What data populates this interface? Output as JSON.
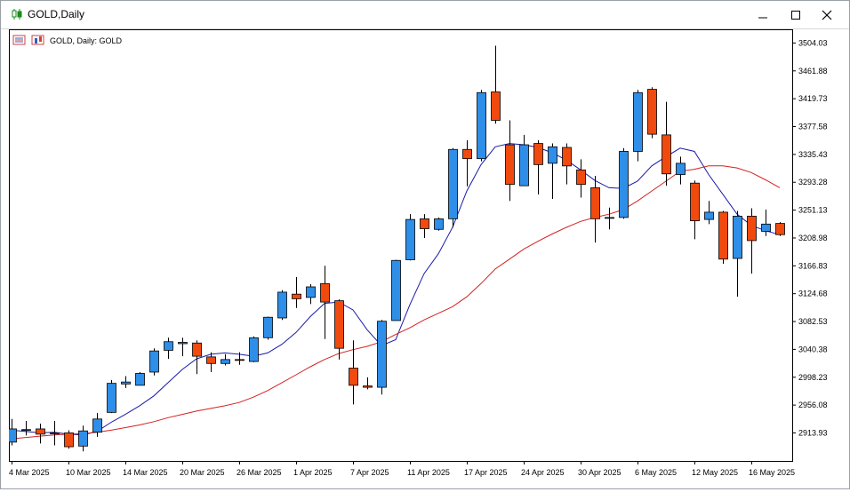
{
  "window": {
    "title": "GOLD,Daily",
    "icons": {
      "app": "candlestick-icon",
      "minimize": "minimize-icon",
      "maximize": "maximize-icon",
      "close": "close-icon"
    }
  },
  "chart_header": {
    "label": "GOLD, Daily:  GOLD",
    "icons": [
      "indicator-list-icon",
      "chart-type-icon"
    ]
  },
  "colors": {
    "bull": "#2e8ee8",
    "bear": "#f04a0f",
    "ma_fast": "#1a1aa8",
    "ma_slow": "#d42020",
    "axis": "#000000"
  },
  "chart_data": {
    "type": "candlestick",
    "symbol": "GOLD",
    "timeframe": "Daily",
    "ylim": [
      2885,
      3510
    ],
    "y_ticks": [
      "3504.03",
      "3461.88",
      "3419.73",
      "3377.58",
      "3335.43",
      "3293.28",
      "3251.13",
      "3208.98",
      "3166.83",
      "3124.68",
      "3082.53",
      "3040.38",
      "2998.23",
      "2956.08",
      "2913.93"
    ],
    "x_tick_labels": [
      {
        "index": 0,
        "label": "4 Mar 2025"
      },
      {
        "index": 4,
        "label": "10 Mar 2025"
      },
      {
        "index": 8,
        "label": "14 Mar 2025"
      },
      {
        "index": 12,
        "label": "20 Mar 2025"
      },
      {
        "index": 16,
        "label": "26 Mar 2025"
      },
      {
        "index": 20,
        "label": "1 Apr 2025"
      },
      {
        "index": 24,
        "label": "7 Apr 2025"
      },
      {
        "index": 28,
        "label": "11 Apr 2025"
      },
      {
        "index": 32,
        "label": "17 Apr 2025"
      },
      {
        "index": 36,
        "label": "24 Apr 2025"
      },
      {
        "index": 40,
        "label": "30 Apr 2025"
      },
      {
        "index": 44,
        "label": "6 May 2025"
      },
      {
        "index": 48,
        "label": "12 May 2025"
      },
      {
        "index": 52,
        "label": "16 May 2025"
      }
    ],
    "candles": [
      {
        "o": 2900,
        "h": 2935,
        "l": 2895,
        "c": 2920
      },
      {
        "o": 2918,
        "h": 2932,
        "l": 2910,
        "c": 2919
      },
      {
        "o": 2920,
        "h": 2928,
        "l": 2898,
        "c": 2912
      },
      {
        "o": 2914,
        "h": 2932,
        "l": 2895,
        "c": 2914
      },
      {
        "o": 2914,
        "h": 2918,
        "l": 2890,
        "c": 2893
      },
      {
        "o": 2894,
        "h": 2925,
        "l": 2886,
        "c": 2917
      },
      {
        "o": 2915,
        "h": 2944,
        "l": 2908,
        "c": 2935
      },
      {
        "o": 2945,
        "h": 2994,
        "l": 2944,
        "c": 2989
      },
      {
        "o": 2988,
        "h": 3000,
        "l": 2982,
        "c": 2991
      },
      {
        "o": 2986,
        "h": 3006,
        "l": 2986,
        "c": 3004
      },
      {
        "o": 3006,
        "h": 3042,
        "l": 3001,
        "c": 3038
      },
      {
        "o": 3039,
        "h": 3058,
        "l": 3026,
        "c": 3052
      },
      {
        "o": 3049,
        "h": 3058,
        "l": 3030,
        "c": 3051
      },
      {
        "o": 3050,
        "h": 3054,
        "l": 3003,
        "c": 3030
      },
      {
        "o": 3029,
        "h": 3036,
        "l": 3006,
        "c": 3019
      },
      {
        "o": 3019,
        "h": 3033,
        "l": 3016,
        "c": 3025
      },
      {
        "o": 3025,
        "h": 3036,
        "l": 3017,
        "c": 3024
      },
      {
        "o": 3022,
        "h": 3060,
        "l": 3021,
        "c": 3058
      },
      {
        "o": 3058,
        "h": 3090,
        "l": 3055,
        "c": 3089
      },
      {
        "o": 3088,
        "h": 3130,
        "l": 3085,
        "c": 3127
      },
      {
        "o": 3124,
        "h": 3150,
        "l": 3103,
        "c": 3117
      },
      {
        "o": 3119,
        "h": 3139,
        "l": 3109,
        "c": 3135
      },
      {
        "o": 3140,
        "h": 3167,
        "l": 3056,
        "c": 3112
      },
      {
        "o": 3114,
        "h": 3116,
        "l": 3025,
        "c": 3042
      },
      {
        "o": 3012,
        "h": 3054,
        "l": 2957,
        "c": 2986
      },
      {
        "o": 2985,
        "h": 2998,
        "l": 2980,
        "c": 2983
      },
      {
        "o": 2983,
        "h": 3085,
        "l": 2972,
        "c": 3083
      },
      {
        "o": 3084,
        "h": 3176,
        "l": 3084,
        "c": 3175
      },
      {
        "o": 3176,
        "h": 3245,
        "l": 3175,
        "c": 3237
      },
      {
        "o": 3238,
        "h": 3245,
        "l": 3209,
        "c": 3223
      },
      {
        "o": 3222,
        "h": 3240,
        "l": 3220,
        "c": 3238
      },
      {
        "o": 3238,
        "h": 3345,
        "l": 3225,
        "c": 3343
      },
      {
        "o": 3343,
        "h": 3357,
        "l": 3287,
        "c": 3329
      },
      {
        "o": 3329,
        "h": 3433,
        "l": 3325,
        "c": 3429
      },
      {
        "o": 3430,
        "h": 3500,
        "l": 3382,
        "c": 3387
      },
      {
        "o": 3350,
        "h": 3387,
        "l": 3265,
        "c": 3290
      },
      {
        "o": 3288,
        "h": 3365,
        "l": 3288,
        "c": 3350
      },
      {
        "o": 3352,
        "h": 3357,
        "l": 3275,
        "c": 3320
      },
      {
        "o": 3322,
        "h": 3352,
        "l": 3268,
        "c": 3347
      },
      {
        "o": 3346,
        "h": 3352,
        "l": 3290,
        "c": 3318
      },
      {
        "o": 3312,
        "h": 3328,
        "l": 3270,
        "c": 3290
      },
      {
        "o": 3285,
        "h": 3303,
        "l": 3202,
        "c": 3238
      },
      {
        "o": 3239,
        "h": 3255,
        "l": 3222,
        "c": 3240
      },
      {
        "o": 3240,
        "h": 3345,
        "l": 3238,
        "c": 3340
      },
      {
        "o": 3340,
        "h": 3433,
        "l": 3325,
        "c": 3429
      },
      {
        "o": 3434,
        "h": 3437,
        "l": 3360,
        "c": 3366
      },
      {
        "o": 3365,
        "h": 3415,
        "l": 3288,
        "c": 3306
      },
      {
        "o": 3305,
        "h": 3332,
        "l": 3290,
        "c": 3322
      },
      {
        "o": 3292,
        "h": 3296,
        "l": 3207,
        "c": 3235
      },
      {
        "o": 3237,
        "h": 3265,
        "l": 3230,
        "c": 3248
      },
      {
        "o": 3248,
        "h": 3250,
        "l": 3170,
        "c": 3177
      },
      {
        "o": 3178,
        "h": 3250,
        "l": 3120,
        "c": 3242
      },
      {
        "o": 3242,
        "h": 3254,
        "l": 3155,
        "c": 3205
      },
      {
        "o": 3219,
        "h": 3252,
        "l": 3212,
        "c": 3230
      },
      {
        "o": 3231,
        "h": 3233,
        "l": 3212,
        "c": 3214
      }
    ],
    "series": [
      {
        "values": [
          2918,
          2916,
          2914,
          2915,
          2912,
          2911,
          2916,
          2930,
          2942,
          2955,
          2970,
          2990,
          3010,
          3026,
          3033,
          3035,
          3033,
          3030,
          3035,
          3048,
          3066,
          3090,
          3110,
          3112,
          3100,
          3070,
          3046,
          3055,
          3108,
          3155,
          3185,
          3225,
          3280,
          3320,
          3347,
          3352,
          3350,
          3346,
          3338,
          3327,
          3312,
          3296,
          3285,
          3284,
          3295,
          3318,
          3332,
          3345,
          3340,
          3305,
          3275,
          3245,
          3228,
          3220,
          3214
        ]
      },
      {
        "values": [
          2905,
          2907,
          2909,
          2911,
          2912,
          2913,
          2915,
          2918,
          2922,
          2926,
          2931,
          2937,
          2942,
          2947,
          2951,
          2955,
          2960,
          2968,
          2978,
          2990,
          3002,
          3014,
          3025,
          3034,
          3040,
          3045,
          3052,
          3063,
          3073,
          3085,
          3095,
          3105,
          3120,
          3140,
          3162,
          3177,
          3192,
          3204,
          3215,
          3225,
          3234,
          3240,
          3245,
          3252,
          3265,
          3280,
          3295,
          3310,
          3313,
          3318,
          3318,
          3315,
          3308,
          3297,
          3285
        ]
      }
    ]
  }
}
